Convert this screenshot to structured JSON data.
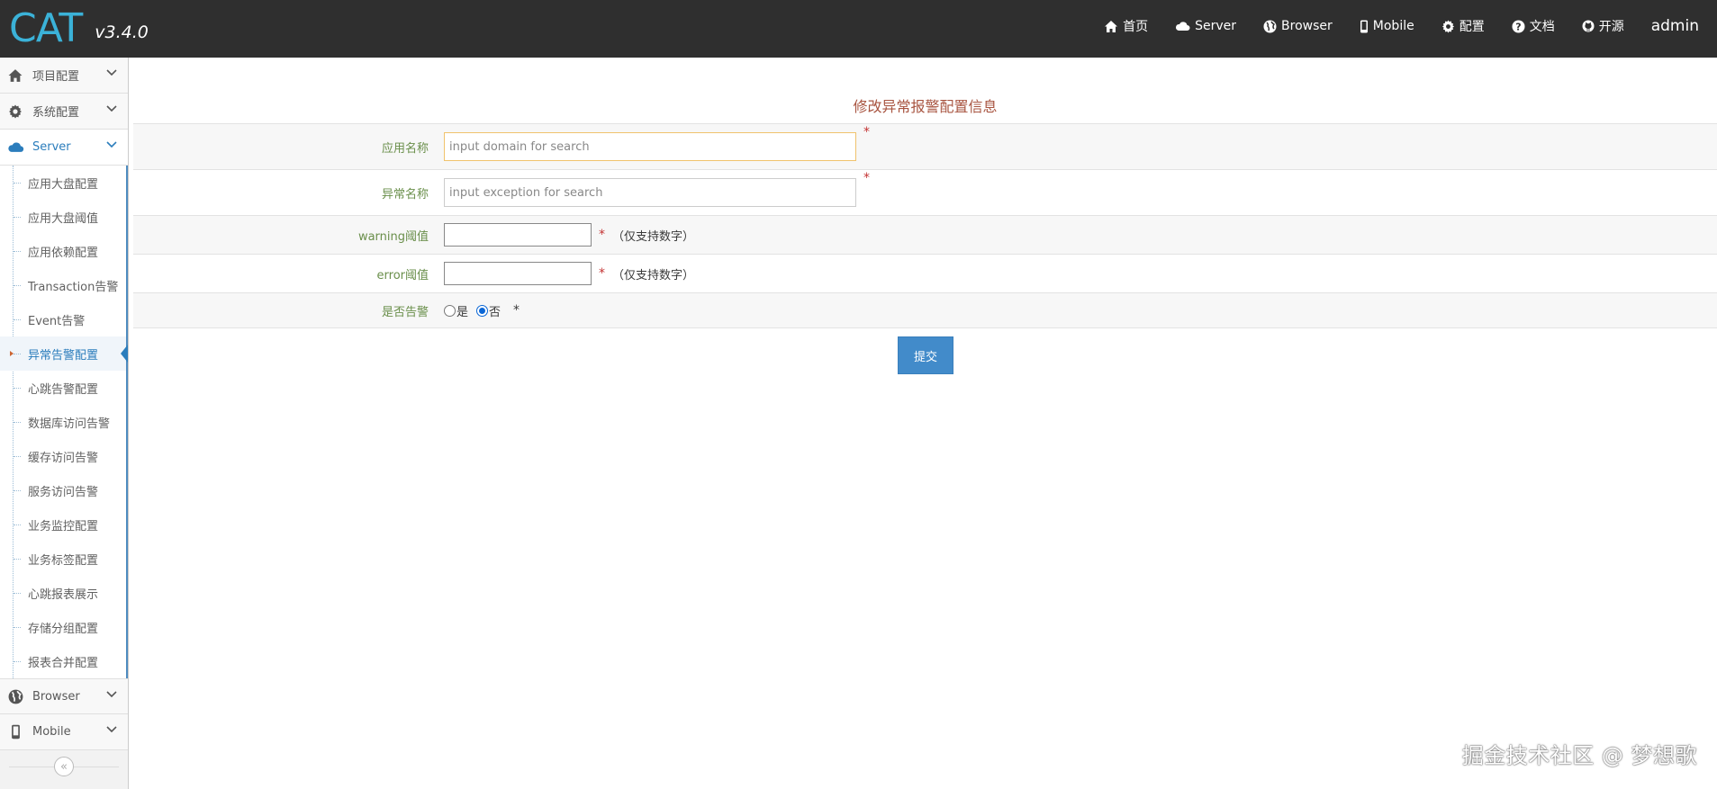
{
  "brand": {
    "logo_text": "CAT",
    "version": "v3.4.0",
    "accent": "#3bb2d8"
  },
  "navbar": {
    "items": [
      {
        "label": "首页",
        "icon": "home-icon"
      },
      {
        "label": "Server",
        "icon": "cloud-icon"
      },
      {
        "label": "Browser",
        "icon": "globe-icon"
      },
      {
        "label": "Mobile",
        "icon": "mobile-icon"
      },
      {
        "label": "配置",
        "icon": "gear-icon"
      },
      {
        "label": "文档",
        "icon": "question-circle-icon"
      },
      {
        "label": "开源",
        "icon": "github-icon"
      }
    ],
    "user": "admin"
  },
  "sidebar": {
    "groups": [
      {
        "label": "项目配置",
        "icon": "home-icon"
      },
      {
        "label": "系统配置",
        "icon": "gear-icon"
      },
      {
        "label": "Server",
        "icon": "cloud-icon"
      },
      {
        "label": "Browser",
        "icon": "globe-icon"
      },
      {
        "label": "Mobile",
        "icon": "mobile-icon"
      }
    ],
    "server_items": [
      "应用大盘配置",
      "应用大盘阈值",
      "应用依赖配置",
      "Transaction告警",
      "Event告警",
      "异常告警配置",
      "心跳告警配置",
      "数据库访问告警",
      "缓存访问告警",
      "服务访问告警",
      "业务监控配置",
      "业务标签配置",
      "心跳报表展示",
      "存储分组配置",
      "报表合并配置"
    ],
    "active_item": "异常告警配置",
    "collapse_glyph": "«"
  },
  "form": {
    "title": "修改异常报警配置信息",
    "domain": {
      "label": "应用名称",
      "placeholder": "input domain for search",
      "value": ""
    },
    "exception": {
      "label": "异常名称",
      "placeholder": "input exception for search",
      "value": ""
    },
    "warning": {
      "label": "warning阈值",
      "value": "",
      "hint": "（仅支持数字）"
    },
    "error": {
      "label": "error阈值",
      "value": "",
      "hint": "（仅支持数字）"
    },
    "alarm": {
      "label": "是否告警",
      "options": [
        "是",
        "否"
      ],
      "selected": "否"
    },
    "required_mark": "*",
    "submit_label": "提交"
  },
  "watermark": "掘金技术社区 @ 梦想歌"
}
